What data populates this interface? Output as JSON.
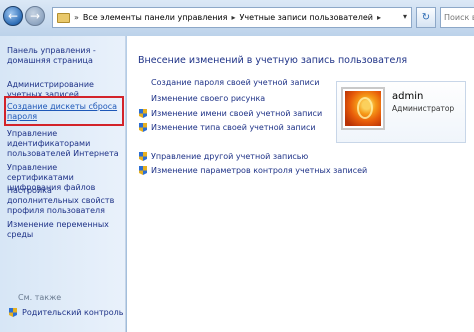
{
  "address": {
    "sep_before": "»",
    "crumbs": [
      "Все элементы панели управления",
      "Учетные записи пользователей"
    ],
    "search_placeholder": "Поиск в пан"
  },
  "sidebar": {
    "items": [
      {
        "label": "Панель управления - домашняя страница"
      },
      {
        "label": "Администрирование учетных записей"
      },
      {
        "label": "Создание дискеты сброса пароля"
      },
      {
        "label": "Управление идентификаторами пользователей Интернета"
      },
      {
        "label": "Управление сертификатами шифрования файлов"
      },
      {
        "label": "Настройка дополнительных свойств профиля пользователя"
      },
      {
        "label": "Изменение переменных среды"
      }
    ],
    "see_also": "См. также",
    "parental": "Родительский контроль"
  },
  "main": {
    "title": "Внесение изменений в учетную запись пользователя",
    "links": [
      {
        "label": "Создание пароля своей учетной записи"
      },
      {
        "label": "Изменение своего рисунка"
      },
      {
        "label": "Изменение имени своей учетной записи"
      },
      {
        "label": "Изменение типа своей учетной записи"
      },
      {
        "label": "Управление другой учетной записью"
      },
      {
        "label": "Изменение параметров контроля учетных записей"
      }
    ]
  },
  "user": {
    "name": "admin",
    "role": "Администратор"
  }
}
